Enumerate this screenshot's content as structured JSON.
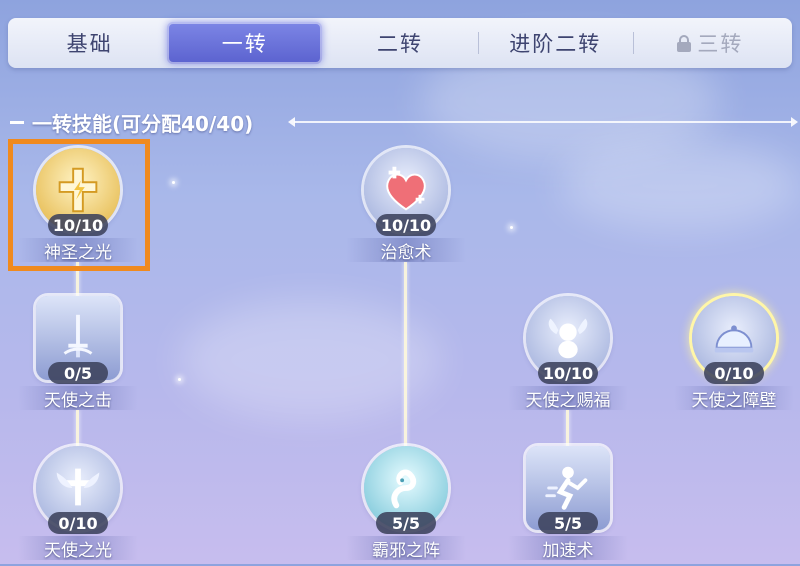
{
  "tabs": [
    {
      "label": "基础",
      "state": "normal"
    },
    {
      "label": "一转",
      "state": "active"
    },
    {
      "label": "二转",
      "state": "normal"
    },
    {
      "label": "进阶二转",
      "state": "normal"
    },
    {
      "label": "三转",
      "state": "locked"
    }
  ],
  "section": {
    "title": "一转技能(可分配40/40)"
  },
  "skills": [
    {
      "name": "神圣之光",
      "level": "10/10",
      "icon": "holy-cross-icon",
      "style": "gold",
      "shape": "circle",
      "selected": true
    },
    {
      "name": "治愈术",
      "level": "10/10",
      "icon": "healing-heart-icon",
      "style": "normal",
      "shape": "circle"
    },
    {
      "name": "天使之击",
      "level": "0/5",
      "icon": "sword-icon",
      "style": "normal",
      "shape": "square"
    },
    {
      "name": "天使之赐福",
      "level": "10/10",
      "icon": "angel-cherub-icon",
      "style": "normal",
      "shape": "circle"
    },
    {
      "name": "天使之障壁",
      "level": "0/10",
      "icon": "barrier-dome-icon",
      "style": "normal",
      "shape": "circle",
      "glow": true
    },
    {
      "name": "天使之光",
      "level": "0/10",
      "icon": "angel-wings-icon",
      "style": "normal",
      "shape": "circle"
    },
    {
      "name": "霸邪之阵",
      "level": "5/5",
      "icon": "serpent-icon",
      "style": "teal",
      "shape": "circle"
    },
    {
      "name": "加速术",
      "level": "5/5",
      "icon": "running-figure-icon",
      "style": "normal",
      "shape": "square"
    }
  ],
  "colors": {
    "selection": "#f08a1e",
    "active_tab": "#5b62cf"
  }
}
